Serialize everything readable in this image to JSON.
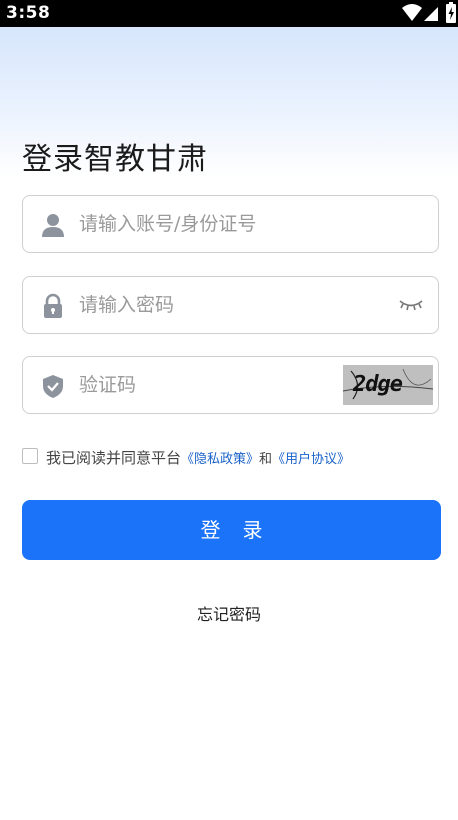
{
  "status_bar": {
    "time": "3:58"
  },
  "page": {
    "title": "登录智教甘肃"
  },
  "form": {
    "account_placeholder": "请输入账号/身份证号",
    "password_placeholder": "请输入密码",
    "captcha_placeholder": "验证码",
    "captcha_image_text": "2dge"
  },
  "agreement": {
    "prefix": "我已阅读并同意平台",
    "privacy_link": "《隐私政策》",
    "connector": "和",
    "user_link": "《用户协议》"
  },
  "actions": {
    "login_label": "登录",
    "forgot_label": "忘记密码"
  },
  "colors": {
    "primary": "#1a73f8",
    "link": "#1a63c9",
    "icon": "#8c939d"
  },
  "icons": [
    "wifi-icon",
    "signal-icon",
    "battery-icon",
    "user-icon",
    "lock-icon",
    "eye-closed-icon",
    "shield-check-icon"
  ]
}
